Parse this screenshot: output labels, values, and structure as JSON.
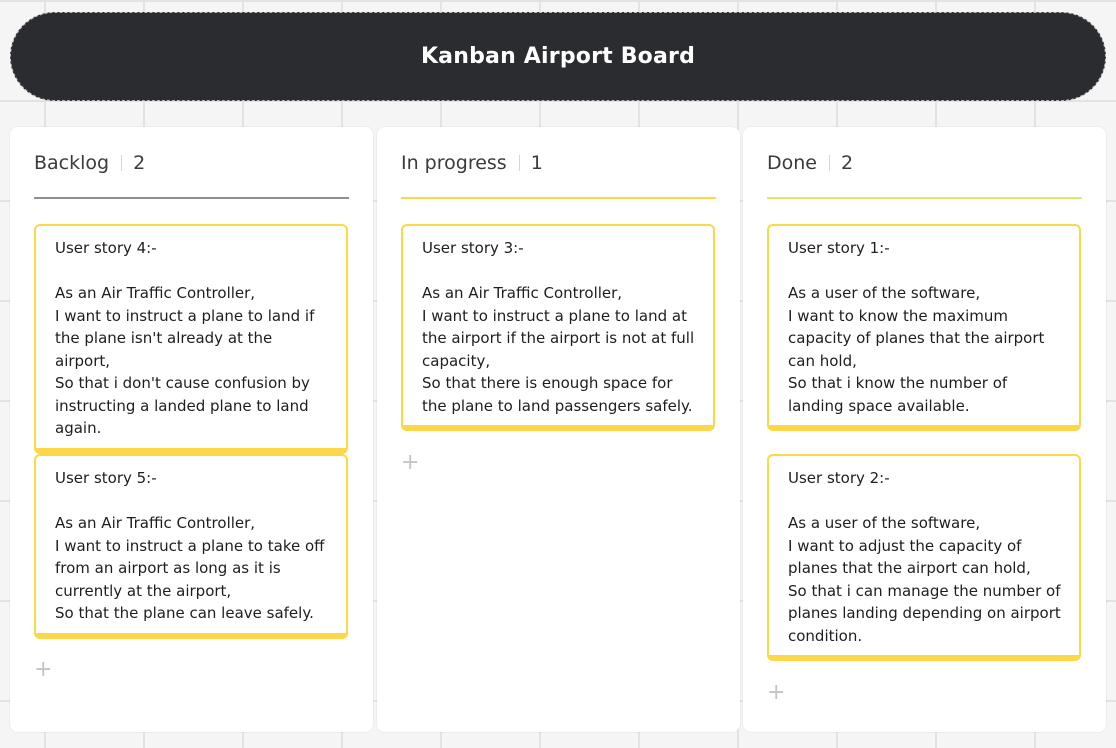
{
  "board": {
    "title": "Kanban Airport Board"
  },
  "colors": {
    "header_bg": "#2b2c30",
    "backlog_rule": "#8f8f8f",
    "in_progress_rule": "#fbd848",
    "done_rule": "#dde86a",
    "card_border": "#fbd848"
  },
  "columns": [
    {
      "title": "Backlog",
      "count": "2",
      "cards": [
        {
          "text": "User story 4:-\n\nAs an Air Traffic Controller,\nI want to instruct a plane to land if the plane isn't already at the airport,\nSo that i don't cause confusion by instructing a landed plane to land again."
        },
        {
          "text": "User story 5:-\n\nAs an Air Traffic Controller,\nI want to instruct a plane to take off from an airport as long as it is currently at the airport,\nSo that the plane can leave safely."
        }
      ],
      "add_icon": "+"
    },
    {
      "title": "In progress",
      "count": "1",
      "cards": [
        {
          "text": "User story 3:-\n\nAs an Air Traffic Controller,\nI want to instruct a plane to land at the airport if the airport is not at full capacity,\nSo that there is enough space for the plane to land passengers safely."
        }
      ],
      "add_icon": "+"
    },
    {
      "title": "Done",
      "count": "2",
      "cards": [
        {
          "text": "User story 1:-\n\nAs a user of the software,\nI want to know the maximum capacity of planes that the airport can hold,\nSo that i know the number of landing space available."
        },
        {
          "text": "User story 2:-\n\nAs a user of the software,\nI want to adjust the capacity of planes that the airport can hold,\nSo that i can manage the number of planes landing depending on airport condition."
        }
      ],
      "add_icon": "+"
    }
  ]
}
